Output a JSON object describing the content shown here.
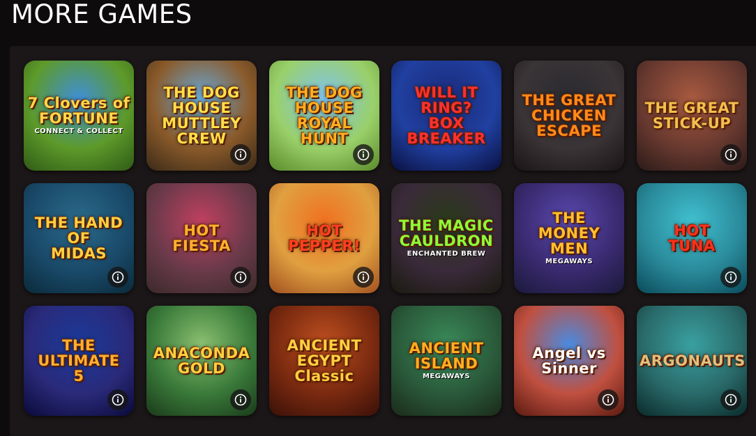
{
  "section": {
    "title": "MORE GAMES"
  },
  "games": [
    {
      "title": "7 Clovers of\nFORTUNE",
      "subtitle": "CONNECT & COLLECT",
      "bg": [
        "#3f8fd8",
        "#5d9a2a",
        "#2f5a16"
      ],
      "title_color": "#ffd84a",
      "info": false
    },
    {
      "title": "THE DOG HOUSE\nMUTTLEY\nCREW",
      "subtitle": "",
      "bg": [
        "#6aa9d8",
        "#8a5a2a",
        "#3a2a18"
      ],
      "title_color": "#ffe04a",
      "info": true
    },
    {
      "title": "THE DOG\nHOUSE\nROYAL HUNT",
      "subtitle": "",
      "bg": [
        "#7fc3f0",
        "#9ad06a",
        "#5a8a2a"
      ],
      "title_color": "#ffb020",
      "info": true
    },
    {
      "title": "WILL IT\nRING?\nBOX BREAKER",
      "subtitle": "",
      "bg": [
        "#1b2a7a",
        "#2040a0",
        "#0a1040"
      ],
      "title_color": "#ff3030",
      "info": false
    },
    {
      "title": "THE GREAT\nCHICKEN\nESCAPE",
      "subtitle": "",
      "bg": [
        "#2a2a30",
        "#3a3436",
        "#1a1416"
      ],
      "title_color": "#ff8a1a",
      "info": false
    },
    {
      "title": "THE GREAT\nSTICK-UP",
      "subtitle": "",
      "bg": [
        "#a85a40",
        "#6a3a30",
        "#2a1a18"
      ],
      "title_color": "#f0c050",
      "info": true
    },
    {
      "title": "THE HAND OF\nMIDAS",
      "subtitle": "",
      "bg": [
        "#2a6a8a",
        "#1a4a6a",
        "#0a2a3a"
      ],
      "title_color": "#ffd040",
      "info": true
    },
    {
      "title": "HOT\nFIESTA",
      "subtitle": "",
      "bg": [
        "#c04060",
        "#6a3a4a",
        "#3a2a2a"
      ],
      "title_color": "#ffb030",
      "info": true
    },
    {
      "title": "HOT\nPEPPER!",
      "subtitle": "",
      "bg": [
        "#f07020",
        "#e0a040",
        "#a05020"
      ],
      "title_color": "#ff4020",
      "info": true
    },
    {
      "title": "THE MAGIC\nCAULDRON",
      "subtitle": "ENCHANTED BREW",
      "bg": [
        "#2a3a1a",
        "#3a2a3a",
        "#1a1a10"
      ],
      "title_color": "#8aff3a",
      "info": false
    },
    {
      "title": "THE\nMONEY\nMEN",
      "subtitle": "MEGAWAYS",
      "bg": [
        "#5a4ab0",
        "#3a2a70",
        "#1a1a3a"
      ],
      "title_color": "#ffc030",
      "info": false
    },
    {
      "title": "HOT\nTUNA",
      "subtitle": "",
      "bg": [
        "#40c0d0",
        "#2a8a9a",
        "#0a4a5a"
      ],
      "title_color": "#ff3020",
      "info": true
    },
    {
      "title": "THE\nULTIMATE\n5",
      "subtitle": "",
      "bg": [
        "#1a3a9a",
        "#2a2a7a",
        "#0a0a3a"
      ],
      "title_color": "#ffb030",
      "info": true
    },
    {
      "title": "ANACONDA\nGOLD",
      "subtitle": "",
      "bg": [
        "#8ac070",
        "#3a7a3a",
        "#1a3a1a"
      ],
      "title_color": "#ffd040",
      "info": true
    },
    {
      "title": "ANCIENT\nEGYPT\nClassic",
      "subtitle": "",
      "bg": [
        "#c05020",
        "#7a2a10",
        "#3a1008"
      ],
      "title_color": "#ffd040",
      "info": false
    },
    {
      "title": "ANCIENT\nISLAND",
      "subtitle": "MEGAWAYS",
      "bg": [
        "#3a8a5a",
        "#2a5a3a",
        "#1a2a1a"
      ],
      "title_color": "#ffb020",
      "info": false
    },
    {
      "title": "Angel vs\nSinner",
      "subtitle": "",
      "bg": [
        "#4a8ae0",
        "#c05040",
        "#5a1a10"
      ],
      "title_color": "#ffffff",
      "info": true
    },
    {
      "title": "ARGONAUTS",
      "subtitle": "",
      "bg": [
        "#3aa0a0",
        "#2a6a6a",
        "#0a2a2a"
      ],
      "title_color": "#e0c080",
      "info": true
    }
  ],
  "icons": {
    "info": "info-circle-icon"
  }
}
